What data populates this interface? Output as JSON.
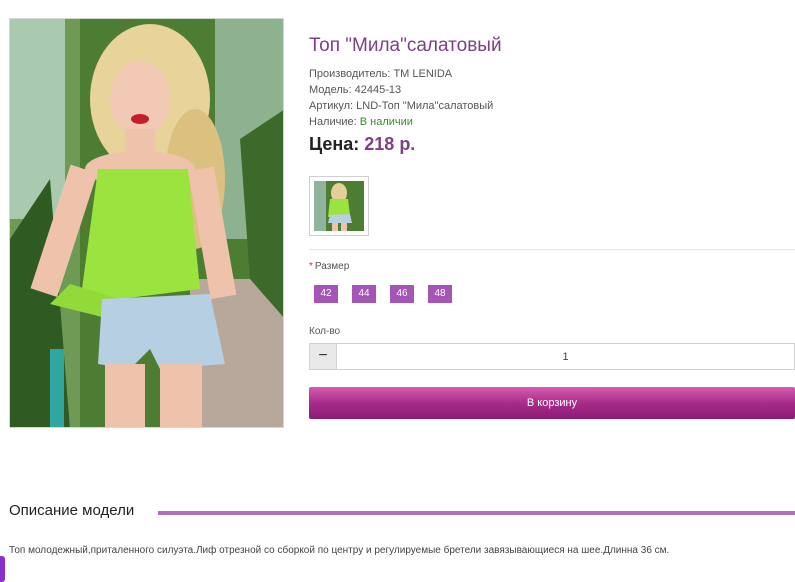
{
  "product": {
    "title": "Топ \"Мила\"салатовый",
    "manufacturer_label": "Производитель:",
    "manufacturer": "ТМ LENIDA",
    "model_label": "Модель:",
    "model": "42445-13",
    "article_label": "Артикул:",
    "article": "LND-Топ \"Мила\"салатовый",
    "availability_label": "Наличие:",
    "availability": "В наличии",
    "price_label": "Цена:",
    "price": "218 р."
  },
  "options": {
    "size_label": "Размер",
    "sizes": [
      "42",
      "44",
      "46",
      "48"
    ]
  },
  "quantity": {
    "label": "Кол-во",
    "minus": "−",
    "value": "1"
  },
  "cart_button": "В корзину",
  "description": {
    "heading": "Описание модели",
    "text": "Топ молодежный,приталенного силуэта.Лиф отрезной со сборкой по центру и регулируемые бретели завязывающиеся на шее.Длинна 36 см."
  },
  "colors": {
    "accent": "#7d3f86",
    "size_button": "#a555b6",
    "cart_button": "#a72d8a",
    "in_stock": "#3a8a2c"
  }
}
